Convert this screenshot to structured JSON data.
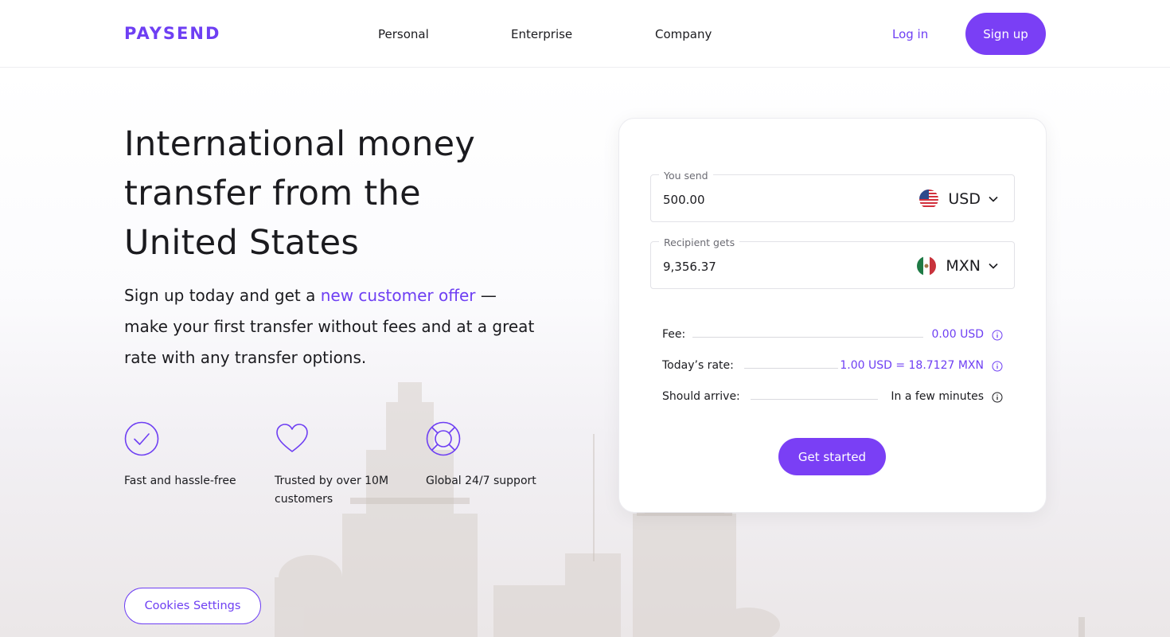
{
  "brand": {
    "name": "PAYSEND",
    "color": "#6e3ff3"
  },
  "nav": {
    "items": [
      "Personal",
      "Enterprise",
      "Company"
    ],
    "login": "Log in",
    "signup": "Sign up"
  },
  "hero": {
    "title": "International money transfer from the United States",
    "subtitle_before": "Sign up today and get a ",
    "subtitle_link": "new customer offer",
    "subtitle_after": " — make your first transfer without fees and at a great rate with any transfer options."
  },
  "features": [
    {
      "icon": "check-circle-icon",
      "label": "Fast and hassle-free"
    },
    {
      "icon": "heart-icon",
      "label": "Trusted by over 10M customers"
    },
    {
      "icon": "lifebuoy-icon",
      "label": "Global 24/7 support"
    }
  ],
  "calculator": {
    "send": {
      "label": "You send",
      "value": "500.00",
      "currency": "USD",
      "flag": "us-flag-icon"
    },
    "receive": {
      "label": "Recipient gets",
      "value": "9,356.37",
      "currency": "MXN",
      "flag": "mexico-flag-icon"
    },
    "fee": {
      "label": "Fee:",
      "value": "0.00 USD"
    },
    "rate": {
      "label": "Today’s rate:",
      "value": "1.00 USD = 18.7127 MXN"
    },
    "arrival": {
      "label": "Should arrive:",
      "value": "In a few minutes"
    },
    "cta": "Get started"
  },
  "cookies": {
    "label": "Cookies Settings"
  }
}
